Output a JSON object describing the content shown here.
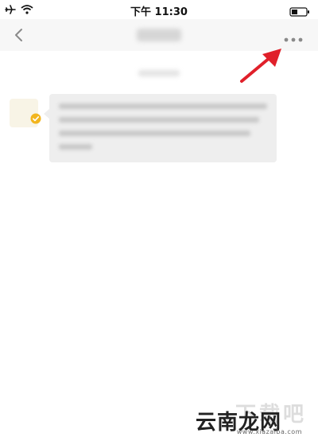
{
  "status_bar": {
    "time": "下午 11:30",
    "icons": [
      "airplane-icon",
      "wifi-icon",
      "battery-icon"
    ]
  },
  "nav": {
    "back_icon": "chevron-left-icon",
    "more_icon": "more-horizontal-icon"
  },
  "watermark": {
    "brand": "云南龙网",
    "url": "www.xiazaiba.com"
  },
  "colors": {
    "nav_background": "#f7f7f7",
    "bubble_background": "#eeeeee",
    "annotation_arrow": "#e0202a",
    "badge": "#f2b51d"
  }
}
